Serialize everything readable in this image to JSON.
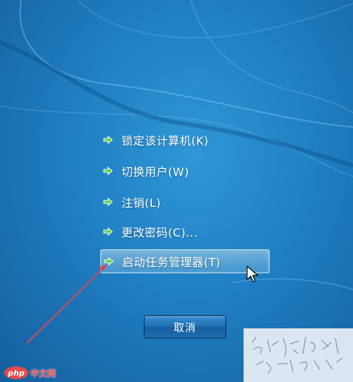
{
  "menu": {
    "items": [
      {
        "label": "锁定该计算机(K)"
      },
      {
        "label": "切换用户(W)"
      },
      {
        "label": "注销(L)"
      },
      {
        "label": "更改密码(C)..."
      },
      {
        "label": "启动任务管理器(T)"
      }
    ],
    "highlighted_index": 4
  },
  "cancel_button": {
    "label": "取消"
  },
  "watermark": {
    "text": "php中文网",
    "logo": "php"
  },
  "colors": {
    "background": "#1f7fc2",
    "highlight": "#cfeaff",
    "button": "#1f6fb3",
    "annotation_arrow": "#d9475a",
    "menu_arrow": "#5fd64a"
  },
  "icons": {
    "menu_arrow": "green-arrow-icon",
    "cursor": "mouse-pointer-icon"
  }
}
